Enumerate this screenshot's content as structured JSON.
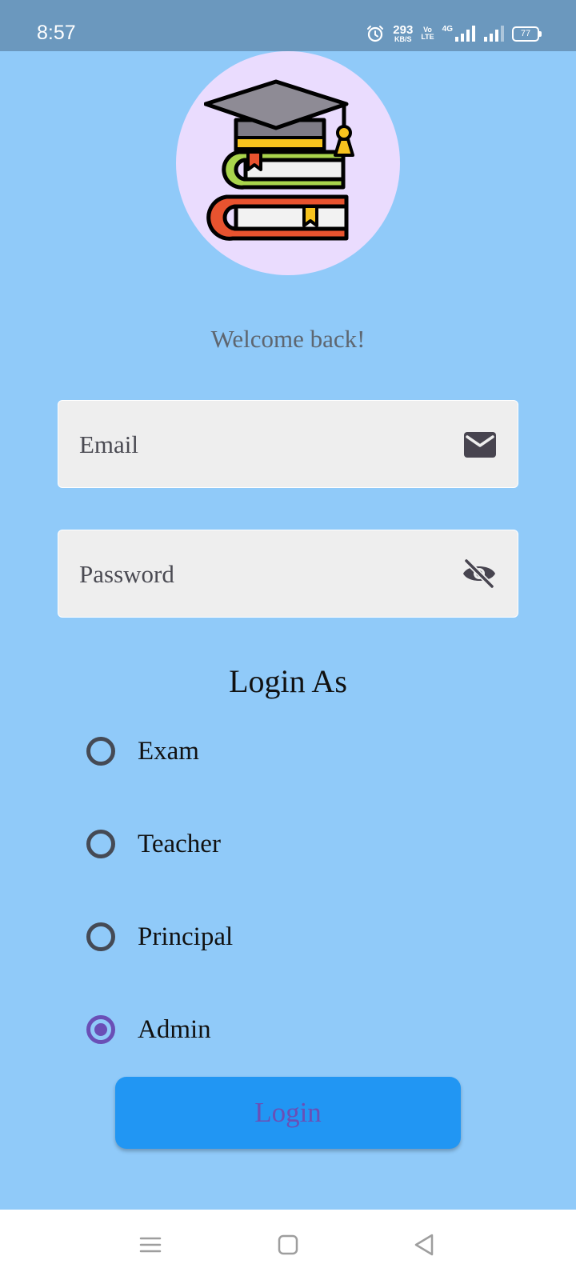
{
  "status_bar": {
    "time": "8:57",
    "net_speed_value": "293",
    "net_speed_unit": "KB/S",
    "volte_top": "Vo",
    "volte_bottom": "LTE",
    "network_type": "4G",
    "battery": "77"
  },
  "welcome_text": "Welcome back!",
  "email_field": {
    "placeholder": "Email",
    "value": ""
  },
  "password_field": {
    "placeholder": "Password",
    "value": ""
  },
  "login_as": {
    "heading": "Login As",
    "options": [
      "Exam",
      "Teacher",
      "Principal",
      "Admin"
    ],
    "selected": "Admin"
  },
  "login_button": "Login",
  "colors": {
    "background": "#90CAF9",
    "status_bar": "#6B98BE",
    "logo_circle": "#EADCFE",
    "field_background": "#EEEEEE",
    "accent_purple": "#6A4FB6",
    "button_blue": "#2196F3"
  },
  "icons": {
    "status": [
      "alarm-icon",
      "signal-icon",
      "signal-icon",
      "battery-icon"
    ],
    "email_trailing": "mail-icon",
    "password_trailing": "visibility-off-icon",
    "navigation": [
      "menu-icon",
      "home-icon",
      "back-icon"
    ]
  }
}
